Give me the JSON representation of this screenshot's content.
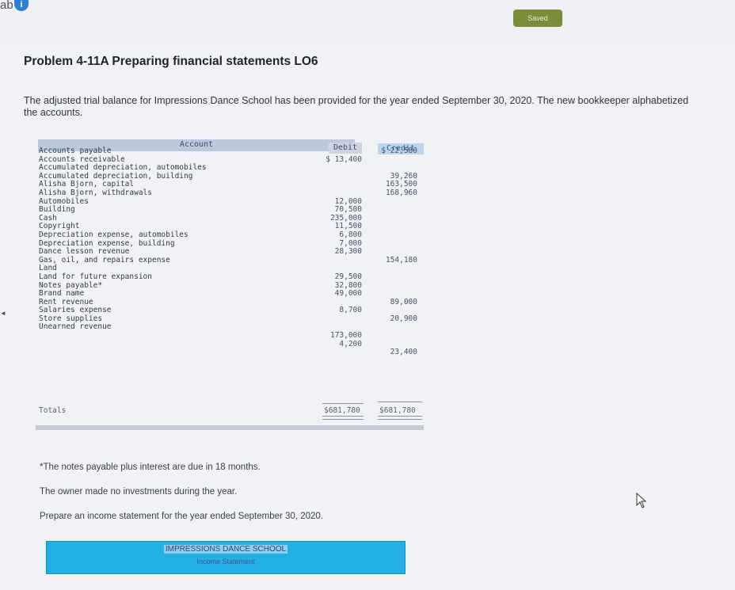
{
  "header": {
    "tab_fragment": "ab",
    "info_icon_glyph": "i",
    "saved_label": "Saved"
  },
  "problem": {
    "title": "Problem 4-11A Preparing financial statements LO6",
    "intro": "The adjusted trial balance for Impressions Dance School has been provided for the year ended September 30, 2020. The new bookkeeper alphabetized the accounts."
  },
  "trial_balance": {
    "headers": {
      "account": "Account",
      "debit": "Debit",
      "credit": "Credit"
    },
    "rows": [
      {
        "account": "Accounts payable",
        "debit": "",
        "credit": "$ 22,580"
      },
      {
        "account": "Accounts receivable",
        "debit": "$ 13,400",
        "credit": ""
      },
      {
        "account": "Accumulated depreciation, automobiles",
        "debit": "",
        "credit": ""
      },
      {
        "account": "Accumulated depreciation, building",
        "debit": "",
        "credit": "39,260"
      },
      {
        "account": "Alisha Bjorn, capital",
        "debit": "",
        "credit": "163,500"
      },
      {
        "account": "Alisha Bjorn, withdrawals",
        "debit": "",
        "credit": "168,960"
      },
      {
        "account": "Automobiles",
        "debit": "12,000",
        "credit": ""
      },
      {
        "account": "Building",
        "debit": "70,500",
        "credit": ""
      },
      {
        "account": "Cash",
        "debit": "235,000",
        "credit": ""
      },
      {
        "account": "Copyright",
        "debit": "11,500",
        "credit": ""
      },
      {
        "account": "Depreciation expense, automobiles",
        "debit": "6,800",
        "credit": ""
      },
      {
        "account": "Depreciation expense, building",
        "debit": "7,000",
        "credit": ""
      },
      {
        "account": "Dance lesson revenue",
        "debit": "28,300",
        "credit": ""
      },
      {
        "account": "Gas, oil, and repairs expense",
        "debit": "",
        "credit": "154,180"
      },
      {
        "account": "Land",
        "debit": "",
        "credit": ""
      },
      {
        "account": "Land for future expansion",
        "debit": "29,500",
        "credit": ""
      },
      {
        "account": "Notes payable*",
        "debit": "32,800",
        "credit": ""
      },
      {
        "account": "Brand name",
        "debit": "49,000",
        "credit": ""
      },
      {
        "account": "Rent revenue",
        "debit": "",
        "credit": "89,000"
      },
      {
        "account": "Salaries expense",
        "debit": "8,700",
        "credit": ""
      },
      {
        "account": "Store supplies",
        "debit": "",
        "credit": "20,900"
      },
      {
        "account": "Unearned revenue",
        "debit": "",
        "credit": ""
      },
      {
        "account": "",
        "debit": "173,000",
        "credit": ""
      },
      {
        "account": "",
        "debit": "4,200",
        "credit": ""
      },
      {
        "account": "",
        "debit": "",
        "credit": "23,400"
      }
    ],
    "totals": {
      "label": "Totals",
      "debit": "$681,780",
      "credit": "$681,780"
    }
  },
  "notes": {
    "footnote": "*The notes payable plus interest are due in 18 months.",
    "no_investments": "The owner made no investments during the year.",
    "instruction": "Prepare an income statement for the year ended September 30, 2020."
  },
  "income_statement": {
    "company": "IMPRESSIONS DANCE SCHOOL",
    "statement": "Income Statement"
  },
  "colors": {
    "accent": "#22b0e6",
    "saved": "#7b8c3a",
    "header_blue": "#bcc8dc"
  }
}
